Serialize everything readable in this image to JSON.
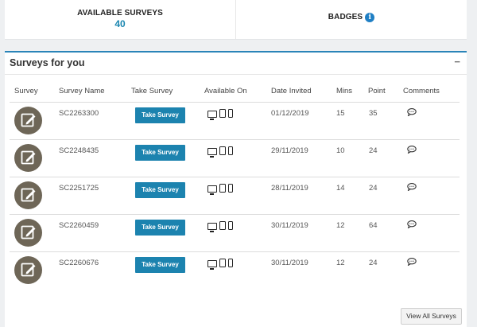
{
  "summary": {
    "available_label": "AVAILABLE SURVEYS",
    "available_count": "40",
    "badges_label": "BADGES",
    "badges_icon": "info-icon"
  },
  "panel": {
    "title": "Surveys for you",
    "collapse_symbol": "−",
    "columns": {
      "survey": "Survey",
      "survey_name": "Survey Name",
      "take_survey": "Take Survey",
      "available_on": "Available On",
      "date_invited": "Date Invited",
      "mins": "Mins",
      "point": "Point",
      "comments": "Comments"
    },
    "rows": [
      {
        "name": "SC2263300",
        "button": "Take Survey",
        "date": "01/12/2019",
        "mins": "15",
        "point": "35"
      },
      {
        "name": "SC2248435",
        "button": "Take Survey",
        "date": "29/11/2019",
        "mins": "10",
        "point": "24"
      },
      {
        "name": "SC2251725",
        "button": "Take Survey",
        "date": "28/11/2019",
        "mins": "14",
        "point": "24"
      },
      {
        "name": "SC2260459",
        "button": "Take Survey",
        "date": "30/11/2019",
        "mins": "12",
        "point": "64"
      },
      {
        "name": "SC2260676",
        "button": "Take Survey",
        "date": "30/11/2019",
        "mins": "12",
        "point": "24"
      }
    ],
    "view_all_label": "View All Surveys"
  },
  "colors": {
    "accent": "#1c83af",
    "avatar": "#6e6657"
  }
}
